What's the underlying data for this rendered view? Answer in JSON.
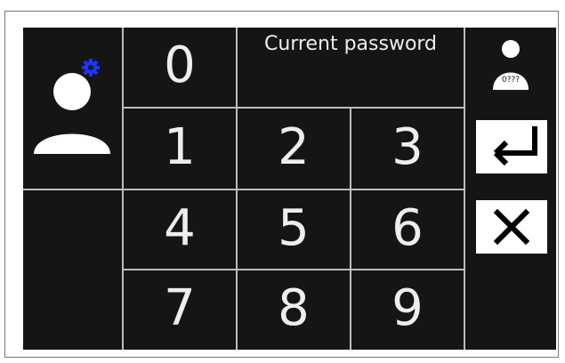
{
  "keypad": {
    "title": "Current password",
    "digits": {
      "d0": "0",
      "d1": "1",
      "d2": "2",
      "d3": "3",
      "d4": "4",
      "d5": "5",
      "d6": "6",
      "d7": "7",
      "d8": "8",
      "d9": "9"
    }
  },
  "user_icon_badge_text": "0???",
  "colors": {
    "panel_bg": "#151515",
    "grid_lines": "#bdbdbd",
    "text": "#eeeeee",
    "gear": "#1a35ff"
  }
}
